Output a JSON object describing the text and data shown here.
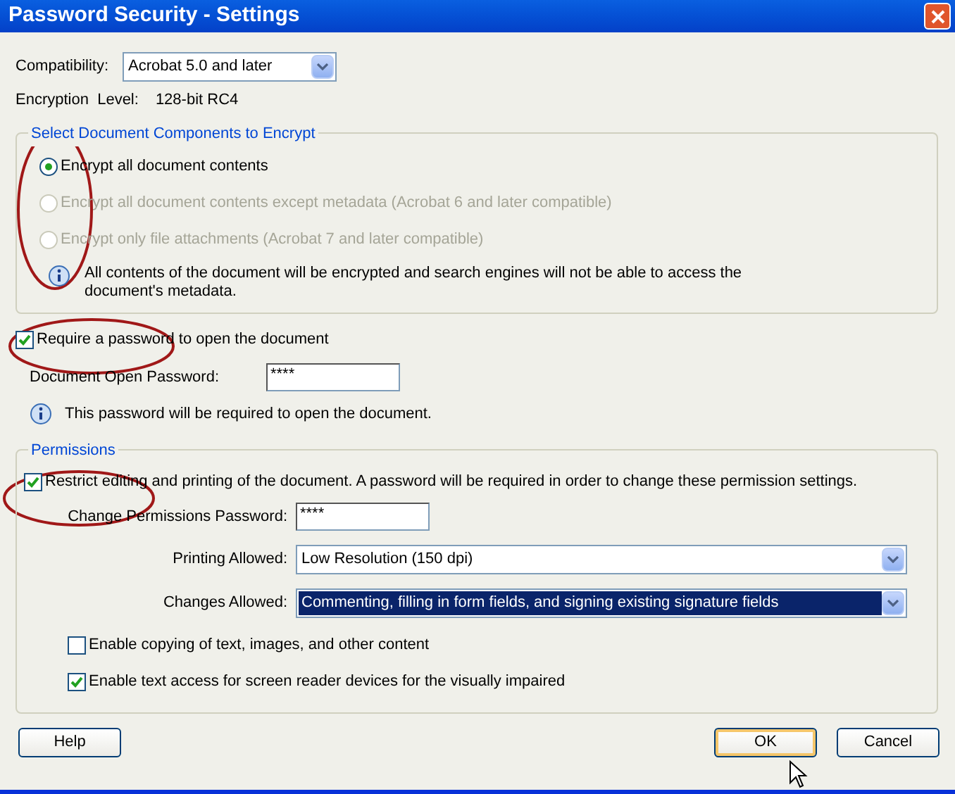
{
  "window": {
    "title": "Password Security - Settings"
  },
  "compatibility": {
    "label": "Compatibility:",
    "value": "Acrobat 5.0 and later"
  },
  "encryption": {
    "label": "Encryption  Level:",
    "value": "128-bit RC4"
  },
  "components": {
    "title": "Select Document Components to Encrypt",
    "options": [
      {
        "label": "Encrypt all document contents",
        "selected": true,
        "disabled": false
      },
      {
        "label": "Encrypt all document contents except metadata (Acrobat 6 and later compatible)",
        "selected": false,
        "disabled": true
      },
      {
        "label": "Encrypt only file attachments (Acrobat 7 and later compatible)",
        "selected": false,
        "disabled": true
      }
    ],
    "info": "All contents of the document will be encrypted and search engines will not be able to access the document's metadata."
  },
  "require_password": {
    "label": "Require a password to open the document",
    "checked": true
  },
  "open_password": {
    "label": "Document Open Password:",
    "value": "****"
  },
  "open_info": "This password will be required to open the document.",
  "permissions": {
    "title": "Permissions",
    "restrict": {
      "label": "Restrict editing and printing of the document. A password will be required in order to change these permission settings.",
      "checked": true
    },
    "password": {
      "label": "Change Permissions Password:",
      "value": "****"
    },
    "dropdowns": [
      {
        "label": "Printing Allowed:",
        "value": "Low Resolution (150 dpi)",
        "highlighted": false
      },
      {
        "label": "Changes Allowed:",
        "value": "Commenting, filling in form fields, and signing existing signature fields",
        "highlighted": true
      }
    ],
    "checkboxes": [
      {
        "label": "Enable copying of text, images, and other content",
        "checked": false
      },
      {
        "label": "Enable text access for screen reader devices for the visually impaired",
        "checked": true
      }
    ]
  },
  "buttons": [
    {
      "label": "Help",
      "default": false
    },
    {
      "label": "OK",
      "default": true
    },
    {
      "label": "Cancel",
      "default": false
    }
  ]
}
